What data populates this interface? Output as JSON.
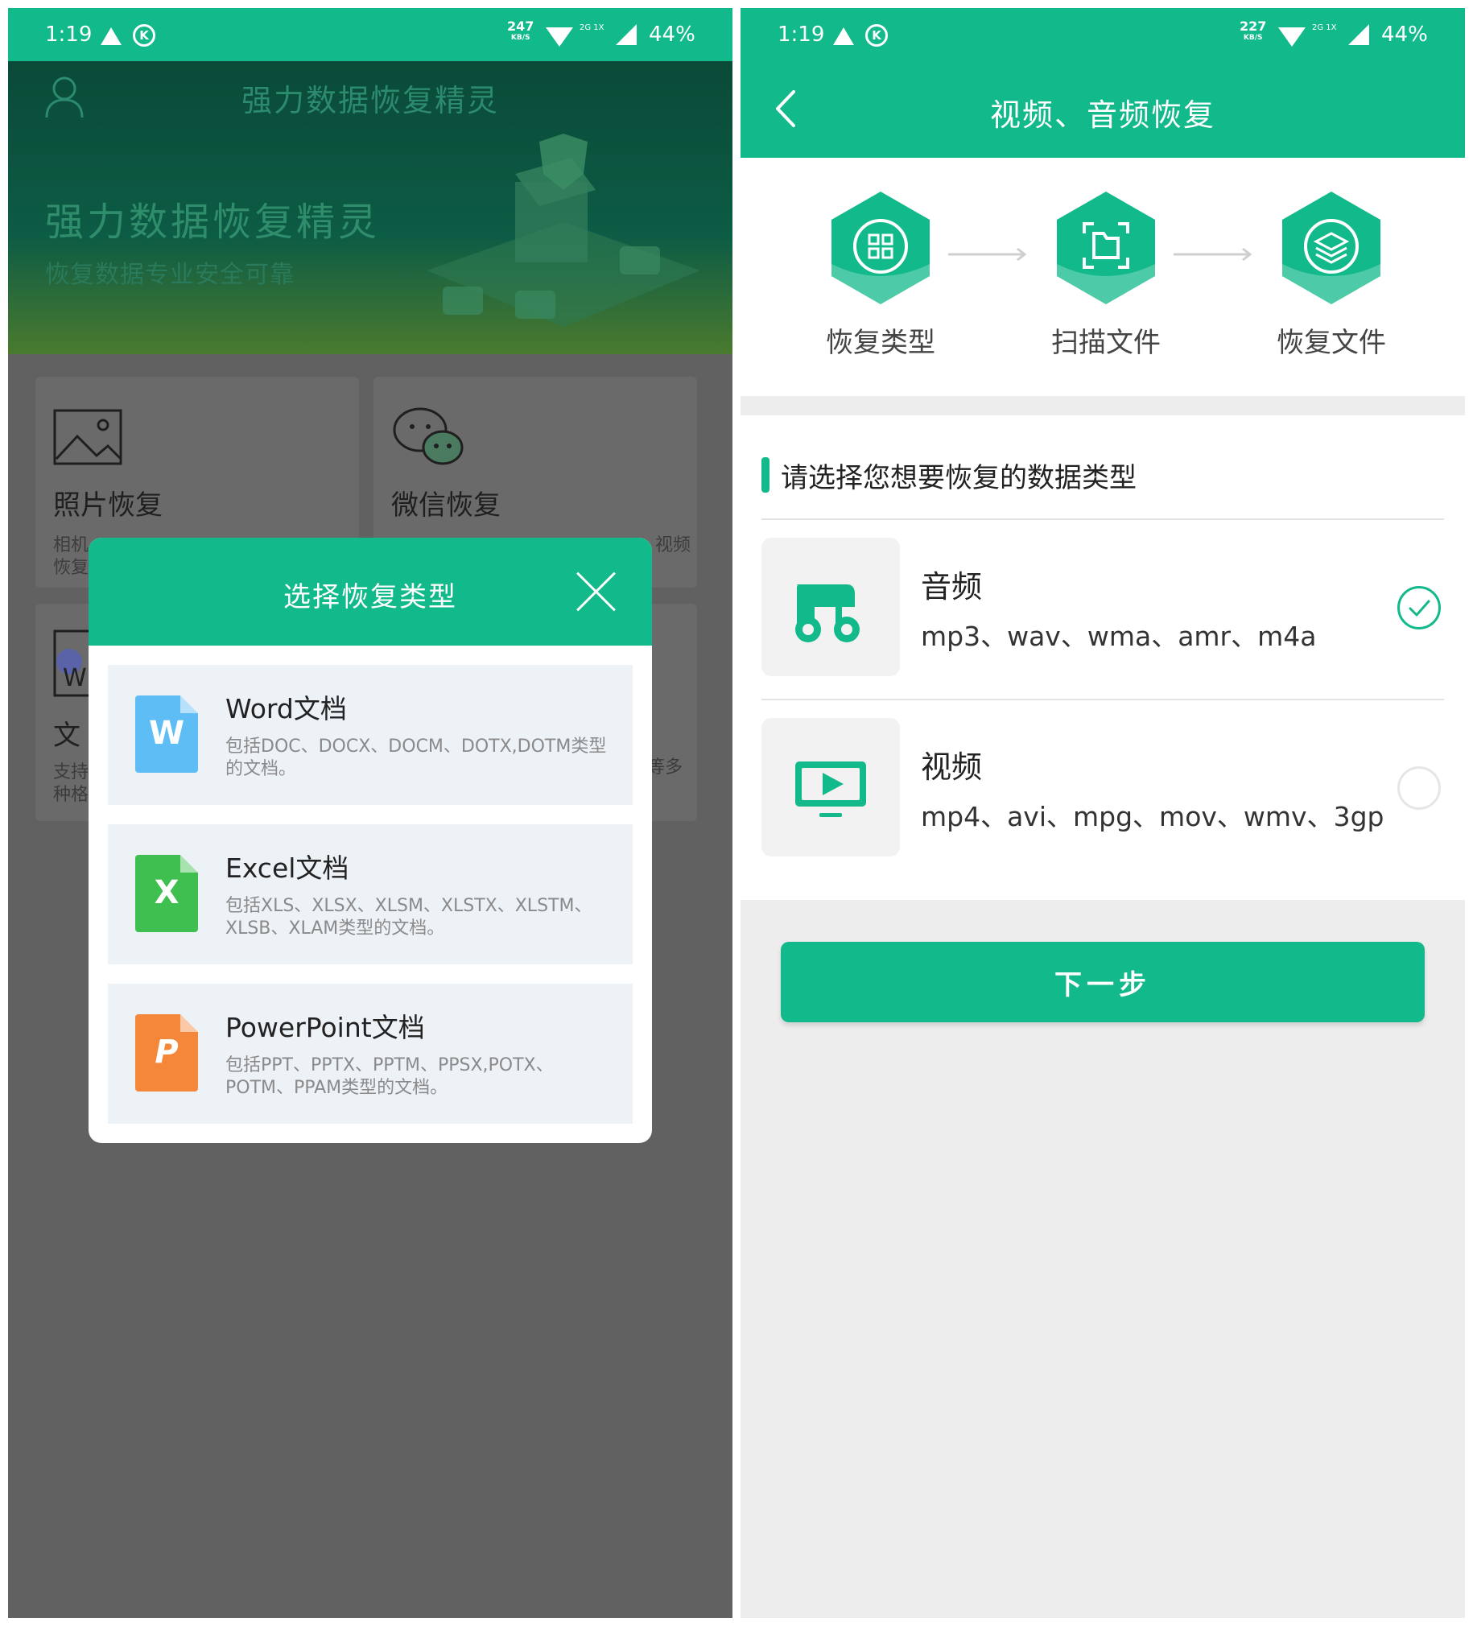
{
  "statusbar_left": {
    "time": "1:19",
    "net_speed": "247",
    "net_unit": "KB/S",
    "network": "2G 1X",
    "battery": "44%"
  },
  "statusbar_right": {
    "time": "1:19",
    "net_speed": "227",
    "net_unit": "KB/S",
    "network": "2G 1X",
    "battery": "44%"
  },
  "home": {
    "app_title": "强力数据恢复精灵",
    "hero_title": "强力数据恢复精灵",
    "hero_subtitle": "恢复数据专业安全可靠",
    "cards": [
      {
        "title": "照片恢复",
        "desc": "相机\n恢复",
        "icon": "image-icon"
      },
      {
        "title": "微信恢复",
        "desc": "视频",
        "icon": "wechat-icon"
      },
      {
        "title": "文",
        "desc": "支持\n种格",
        "icon": "word-doc-icon"
      },
      {
        "title": "",
        "desc": "等多",
        "icon": ""
      }
    ]
  },
  "dialog": {
    "title": "选择恢复类型",
    "items": [
      {
        "name": "Word文档",
        "desc": "包括DOC、DOCX、DOCM、DOTX,DOTM类型的文档。",
        "letter": "W",
        "color": "#5fbdf5",
        "icon": "word-file-icon"
      },
      {
        "name": "Excel文档",
        "desc": "包括XLS、XLSX、XLSM、XLSTX、XLSTM、XLSB、XLAM类型的文档。",
        "letter": "X",
        "color": "#3fbf4f",
        "icon": "excel-file-icon"
      },
      {
        "name": "PowerPoint文档",
        "desc": "包括PPT、PPTX、PPTM、PPSX,POTX、POTM、PPAM类型的文档。",
        "letter": "P",
        "color": "#f5873a",
        "icon": "powerpoint-file-icon"
      }
    ]
  },
  "recovery": {
    "title": "视频、音频恢复",
    "steps": [
      {
        "label": "恢复类型",
        "icon": "grid-icon"
      },
      {
        "label": "扫描文件",
        "icon": "scan-icon"
      },
      {
        "label": "恢复文件",
        "icon": "layers-icon"
      }
    ],
    "section_title": "请选择您想要恢复的数据类型",
    "options": [
      {
        "title": "音频",
        "formats": "mp3、wav、wma、amr、m4a",
        "selected": true,
        "icon": "music-icon"
      },
      {
        "title": "视频",
        "formats": "mp4、avi、mpg、mov、wmv、3gp",
        "selected": false,
        "icon": "monitor-play-icon"
      }
    ],
    "next_button": "下一步"
  },
  "colors": {
    "accent": "#12b98a",
    "overlay": "#616161",
    "panel_bg": "#ededed"
  }
}
